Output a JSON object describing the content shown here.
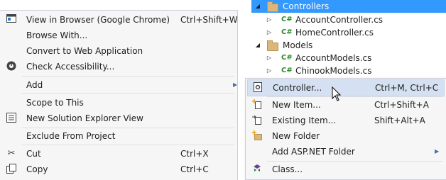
{
  "tree": {
    "items": [
      {
        "label": "Controllers",
        "kind": "folder",
        "selected": true
      },
      {
        "label": "AccountController.cs",
        "kind": "cs"
      },
      {
        "label": "HomeController.cs",
        "kind": "cs"
      },
      {
        "label": "Models",
        "kind": "folder"
      },
      {
        "label": "AccountModels.cs",
        "kind": "cs"
      },
      {
        "label": "ChinookModels.cs",
        "kind": "cs"
      }
    ],
    "cs_badge": "C#"
  },
  "main_menu": {
    "items": [
      {
        "label": "View in Browser (Google Chrome)",
        "shortcut": "Ctrl+Shift+W",
        "icon": "browser-icon"
      },
      {
        "label": "Browse With...",
        "shortcut": ""
      },
      {
        "label": "Convert to Web Application",
        "shortcut": ""
      },
      {
        "label": "Check Accessibility...",
        "shortcut": "",
        "icon": "accessibility-icon"
      },
      {
        "label": "Add",
        "shortcut": "",
        "submenu": true
      },
      {
        "label": "Scope to This",
        "shortcut": ""
      },
      {
        "label": "New Solution Explorer View",
        "shortcut": "",
        "icon": "new-view-icon"
      },
      {
        "label": "Exclude From Project",
        "shortcut": ""
      },
      {
        "label": "Cut",
        "shortcut": "Ctrl+X",
        "icon": "scissors-icon"
      },
      {
        "label": "Copy",
        "shortcut": "Ctrl+C",
        "icon": "copy-icon"
      }
    ]
  },
  "sub_menu": {
    "items": [
      {
        "label": "Controller...",
        "shortcut": "Ctrl+M, Ctrl+C",
        "icon": "controller-icon",
        "highlighted": true
      },
      {
        "label": "New Item...",
        "shortcut": "Ctrl+Shift+A",
        "icon": "new-item-icon"
      },
      {
        "label": "Existing Item...",
        "shortcut": "Shift+Alt+A",
        "icon": "existing-item-icon"
      },
      {
        "label": "New Folder",
        "shortcut": "",
        "icon": "new-folder-icon"
      },
      {
        "label": "Add ASP.NET Folder",
        "shortcut": "",
        "submenu": true
      },
      {
        "label": "Class...",
        "shortcut": "",
        "icon": "class-icon"
      }
    ]
  },
  "colors": {
    "selection": "#3399ff",
    "menu_bg": "#f6f6f6",
    "highlight": "#d5e1f2"
  }
}
